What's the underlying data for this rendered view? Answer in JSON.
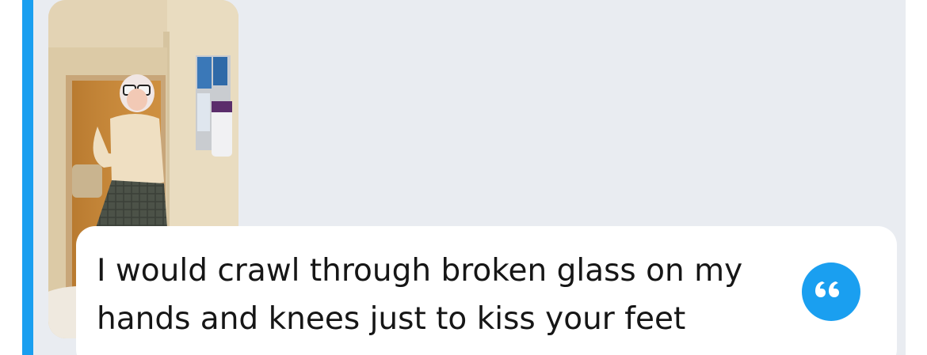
{
  "quote": {
    "text": "I would crawl through broken glass on my hands and knees just to kiss your feet",
    "icon": "quote-marks-icon"
  },
  "colors": {
    "accent": "#1a9ff0",
    "panel_background": "#e9ecf1",
    "card_background": "#ffffff",
    "text": "#161616"
  },
  "photo": {
    "icon": "photo-thumbnail"
  }
}
